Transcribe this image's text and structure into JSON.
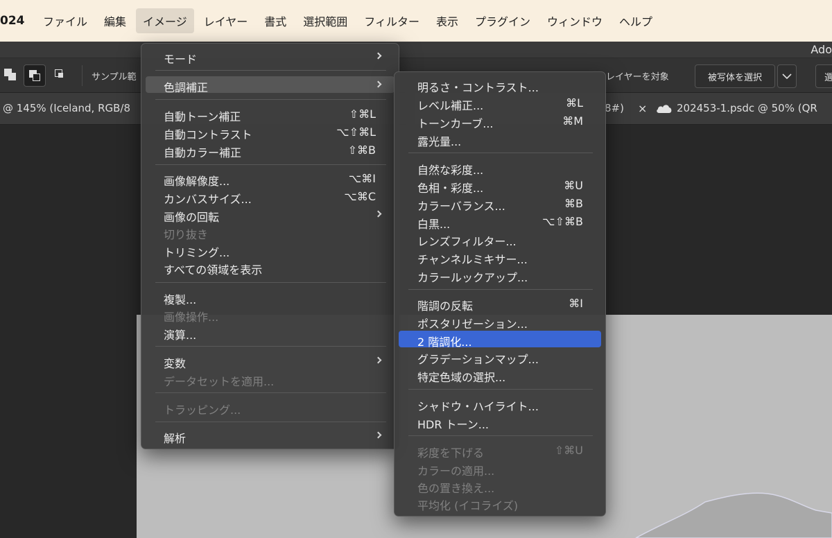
{
  "menubar": {
    "app_fragment": "024",
    "items": [
      "ファイル",
      "編集",
      "イメージ",
      "レイヤー",
      "書式",
      "選択範囲",
      "フィルター",
      "表示",
      "プラグイン",
      "ウィンドウ",
      "ヘルプ"
    ]
  },
  "window": {
    "title_fragment": "Ado"
  },
  "toolbar": {
    "sample_label": "サンプル範",
    "layer_target": "レイヤーを対象",
    "select_subject": "被写体を選択",
    "right_fragment": "選"
  },
  "tabs": {
    "active_doc": "@ 145% (Iceland, RGB/8",
    "hidden_fragment": "8#)",
    "close_symbol": "×",
    "second_doc": "202453-1.psdc @ 50% (QR"
  },
  "image_menu": {
    "items": [
      {
        "label": "モード",
        "shortcut": "",
        "submenu": true,
        "disabled": false
      },
      {
        "label": "色調補正",
        "shortcut": "",
        "submenu": true,
        "disabled": false,
        "open": true
      },
      {
        "label": "自動トーン補正",
        "shortcut": "⇧⌘L",
        "submenu": false,
        "disabled": false
      },
      {
        "label": "自動コントラスト",
        "shortcut": "⌥⇧⌘L",
        "submenu": false,
        "disabled": false
      },
      {
        "label": "自動カラー補正",
        "shortcut": "⇧⌘B",
        "submenu": false,
        "disabled": false
      },
      {
        "label": "画像解像度...",
        "shortcut": "⌥⌘I",
        "submenu": false,
        "disabled": false
      },
      {
        "label": "カンバスサイズ...",
        "shortcut": "⌥⌘C",
        "submenu": false,
        "disabled": false
      },
      {
        "label": "画像の回転",
        "shortcut": "",
        "submenu": true,
        "disabled": false
      },
      {
        "label": "切り抜き",
        "shortcut": "",
        "submenu": false,
        "disabled": true
      },
      {
        "label": "トリミング...",
        "shortcut": "",
        "submenu": false,
        "disabled": false
      },
      {
        "label": "すべての領域を表示",
        "shortcut": "",
        "submenu": false,
        "disabled": false
      },
      {
        "label": "複製...",
        "shortcut": "",
        "submenu": false,
        "disabled": false
      },
      {
        "label": "画像操作...",
        "shortcut": "",
        "submenu": false,
        "disabled": true
      },
      {
        "label": "演算...",
        "shortcut": "",
        "submenu": false,
        "disabled": false
      },
      {
        "label": "変数",
        "shortcut": "",
        "submenu": true,
        "disabled": false
      },
      {
        "label": "データセットを適用...",
        "shortcut": "",
        "submenu": false,
        "disabled": true
      },
      {
        "label": "トラッピング...",
        "shortcut": "",
        "submenu": false,
        "disabled": true
      },
      {
        "label": "解析",
        "shortcut": "",
        "submenu": true,
        "disabled": false
      }
    ]
  },
  "adjust_menu": {
    "items": [
      {
        "label": "明るさ・コントラスト...",
        "shortcut": "",
        "disabled": false
      },
      {
        "label": "レベル補正...",
        "shortcut": "⌘L",
        "disabled": false
      },
      {
        "label": "トーンカーブ...",
        "shortcut": "⌘M",
        "disabled": false
      },
      {
        "label": "露光量...",
        "shortcut": "",
        "disabled": false
      },
      {
        "label": "自然な彩度...",
        "shortcut": "",
        "disabled": false
      },
      {
        "label": "色相・彩度...",
        "shortcut": "⌘U",
        "disabled": false
      },
      {
        "label": "カラーバランス...",
        "shortcut": "⌘B",
        "disabled": false
      },
      {
        "label": "白黒...",
        "shortcut": "⌥⇧⌘B",
        "disabled": false
      },
      {
        "label": "レンズフィルター...",
        "shortcut": "",
        "disabled": false
      },
      {
        "label": "チャンネルミキサー...",
        "shortcut": "",
        "disabled": false
      },
      {
        "label": "カラールックアップ...",
        "shortcut": "",
        "disabled": false
      },
      {
        "label": "階調の反転",
        "shortcut": "⌘I",
        "disabled": false
      },
      {
        "label": "ポスタリゼーション...",
        "shortcut": "",
        "disabled": false
      },
      {
        "label": "2 階調化...",
        "shortcut": "",
        "disabled": false,
        "highlighted": true
      },
      {
        "label": "グラデーションマップ...",
        "shortcut": "",
        "disabled": false
      },
      {
        "label": "特定色域の選択...",
        "shortcut": "",
        "disabled": false
      },
      {
        "label": "シャドウ・ハイライト...",
        "shortcut": "",
        "disabled": false
      },
      {
        "label": "HDR トーン...",
        "shortcut": "",
        "disabled": false
      },
      {
        "label": "彩度を下げる",
        "shortcut": "⇧⌘U",
        "disabled": true
      },
      {
        "label": "カラーの適用...",
        "shortcut": "",
        "disabled": true
      },
      {
        "label": "色の置き換え...",
        "shortcut": "",
        "disabled": true
      },
      {
        "label": "平均化 (イコライズ)",
        "shortcut": "",
        "disabled": true
      }
    ]
  },
  "colors": {
    "menubar_bg": "#f9efdf",
    "menu_bg": "#3e3e3e",
    "highlight": "#3a66d4",
    "disabled_text": "#808080"
  }
}
